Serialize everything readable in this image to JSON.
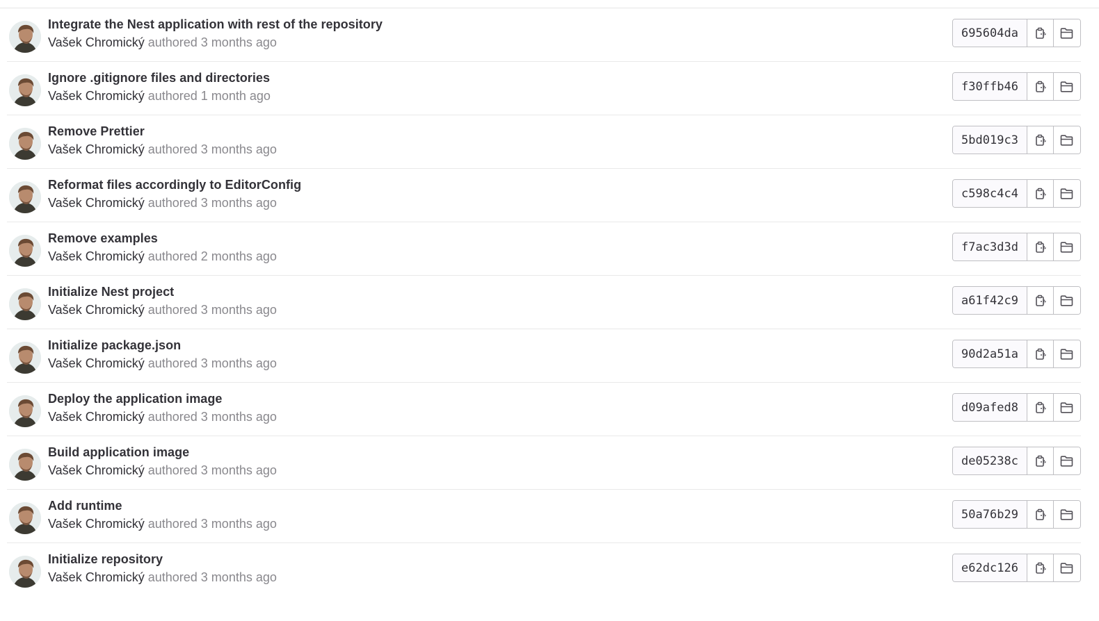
{
  "commits": [
    {
      "title": "Integrate the Nest application with rest of the repository",
      "author": "Vašek Chromický",
      "authored_label": "authored",
      "time": "3 months ago",
      "sha": "695604da"
    },
    {
      "title": "Ignore .gitignore files and directories",
      "author": "Vašek Chromický",
      "authored_label": "authored",
      "time": "1 month ago",
      "sha": "f30ffb46"
    },
    {
      "title": "Remove Prettier",
      "author": "Vašek Chromický",
      "authored_label": "authored",
      "time": "3 months ago",
      "sha": "5bd019c3"
    },
    {
      "title": "Reformat files accordingly to EditorConfig",
      "author": "Vašek Chromický",
      "authored_label": "authored",
      "time": "3 months ago",
      "sha": "c598c4c4"
    },
    {
      "title": "Remove examples",
      "author": "Vašek Chromický",
      "authored_label": "authored",
      "time": "2 months ago",
      "sha": "f7ac3d3d"
    },
    {
      "title": "Initialize Nest project",
      "author": "Vašek Chromický",
      "authored_label": "authored",
      "time": "3 months ago",
      "sha": "a61f42c9"
    },
    {
      "title": "Initialize package.json",
      "author": "Vašek Chromický",
      "authored_label": "authored",
      "time": "3 months ago",
      "sha": "90d2a51a"
    },
    {
      "title": "Deploy the application image",
      "author": "Vašek Chromický",
      "authored_label": "authored",
      "time": "3 months ago",
      "sha": "d09afed8"
    },
    {
      "title": "Build application image",
      "author": "Vašek Chromický",
      "authored_label": "authored",
      "time": "3 months ago",
      "sha": "de05238c"
    },
    {
      "title": "Add runtime",
      "author": "Vašek Chromický",
      "authored_label": "authored",
      "time": "3 months ago",
      "sha": "50a76b29"
    },
    {
      "title": "Initialize repository",
      "author": "Vašek Chromický",
      "authored_label": "authored",
      "time": "3 months ago",
      "sha": "e62dc126"
    }
  ],
  "icons": {
    "copy": "copy-sha-icon",
    "browse": "folder-open-icon"
  },
  "colors": {
    "title_text": "#333238",
    "muted_text": "#89888d",
    "border": "#bfbfc3",
    "divider": "#e9e9e9",
    "sha_bg": "#fbfafd"
  }
}
